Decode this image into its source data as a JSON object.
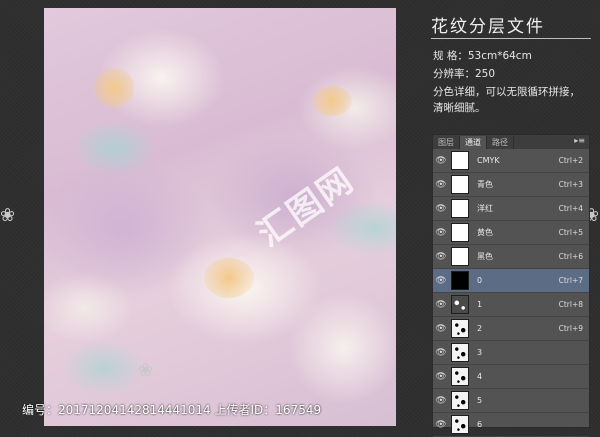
{
  "info": {
    "title": "花纹分层文件",
    "spec_size": "规  格：53cm*64cm",
    "spec_resolution": "分辨率：250",
    "spec_desc1": "分色详细，可以无限循环拼接，",
    "spec_desc2": "清晰细腻。"
  },
  "watermark": "汇图网",
  "footer": {
    "id_line": "编号：20171204142814441014 上传者ID：167549"
  },
  "channels_panel": {
    "tabs": [
      "图层",
      "通道",
      "路径"
    ],
    "active_tab": "通道",
    "menu_icon": "panel-menu-icon",
    "rows": [
      {
        "name": "CMYK",
        "shortcut": "Ctrl+2",
        "thumb": "white"
      },
      {
        "name": "青色",
        "shortcut": "Ctrl+3",
        "thumb": "white"
      },
      {
        "name": "洋红",
        "shortcut": "Ctrl+4",
        "thumb": "white"
      },
      {
        "name": "黄色",
        "shortcut": "Ctrl+5",
        "thumb": "white"
      },
      {
        "name": "黑色",
        "shortcut": "Ctrl+6",
        "thumb": "white"
      },
      {
        "name": "0",
        "shortcut": "Ctrl+7",
        "thumb": "black",
        "selected": true
      },
      {
        "name": "1",
        "shortcut": "Ctrl+8",
        "thumb": "dark"
      },
      {
        "name": "2",
        "shortcut": "Ctrl+9",
        "thumb": "pattern"
      },
      {
        "name": "3",
        "shortcut": "",
        "thumb": "pattern"
      },
      {
        "name": "4",
        "shortcut": "",
        "thumb": "pattern"
      },
      {
        "name": "5",
        "shortcut": "",
        "thumb": "pattern"
      },
      {
        "name": "6",
        "shortcut": "",
        "thumb": "pattern"
      }
    ]
  },
  "colors": {
    "selected_row": "#5d6c85",
    "panel_bg": "#535353",
    "background": "#2f2f2f"
  }
}
